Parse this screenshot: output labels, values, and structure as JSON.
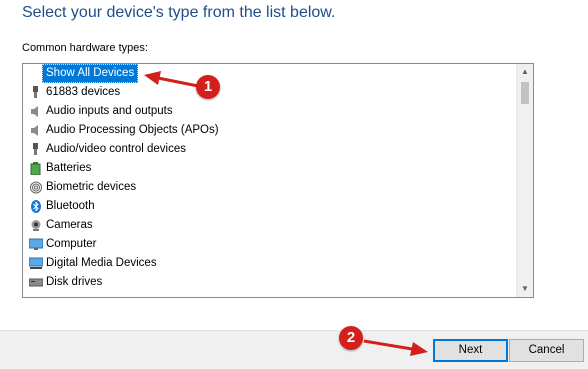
{
  "dialog": {
    "heading": "Select your device's type from the list below.",
    "list_label": "Common hardware types:"
  },
  "device_list": {
    "selected_item": "Show All Devices",
    "items": [
      {
        "label": "Show All Devices",
        "icon": "none"
      },
      {
        "label": "61883 devices",
        "icon": "plug-icon"
      },
      {
        "label": "Audio inputs and outputs",
        "icon": "speaker-icon"
      },
      {
        "label": "Audio Processing Objects (APOs)",
        "icon": "speaker-icon"
      },
      {
        "label": "Audio/video control devices",
        "icon": "plug-icon"
      },
      {
        "label": "Batteries",
        "icon": "battery-icon"
      },
      {
        "label": "Biometric devices",
        "icon": "fingerprint-icon"
      },
      {
        "label": "Bluetooth",
        "icon": "bluetooth-icon"
      },
      {
        "label": "Cameras",
        "icon": "camera-icon"
      },
      {
        "label": "Computer",
        "icon": "monitor-icon"
      },
      {
        "label": "Digital Media Devices",
        "icon": "media-device-icon"
      },
      {
        "label": "Disk drives",
        "icon": "disk-drive-icon"
      }
    ]
  },
  "buttons": {
    "next": "Next",
    "cancel": "Cancel"
  },
  "callouts": {
    "one": "1",
    "two": "2"
  },
  "colors": {
    "heading": "#1f4e8c",
    "selection": "#0078d7",
    "callout": "#d4201b",
    "footer": "#f0f0f0"
  }
}
